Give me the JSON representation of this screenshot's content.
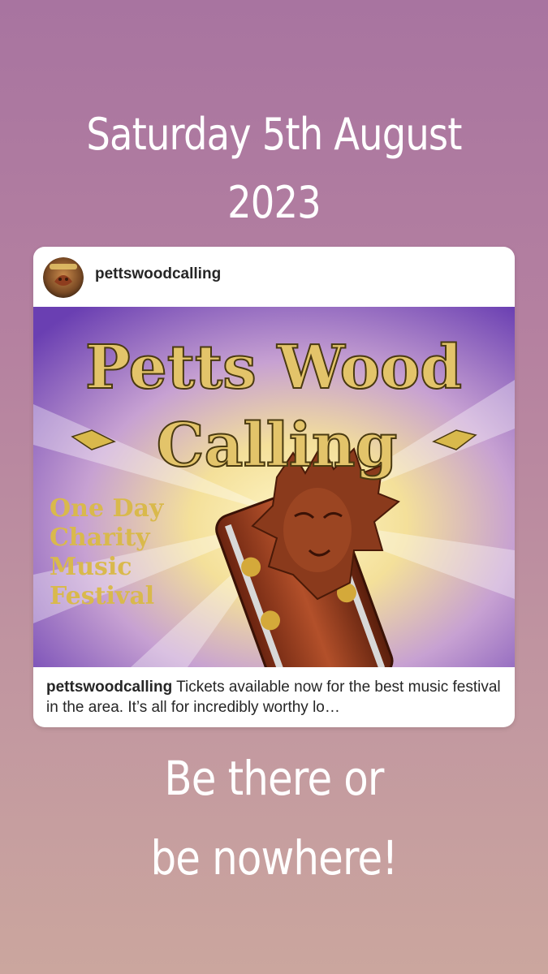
{
  "story": {
    "top_text_line1": "Saturday 5th August",
    "top_text_line2": "2023",
    "bottom_text_line1": "Be there or",
    "bottom_text_line2": "be nowhere!"
  },
  "post": {
    "username": "pettswoodcalling",
    "caption_user": "pettswoodcalling",
    "caption_text": " Tickets available now for the best music festival in the area. It’s all for incredibly worthy lo…",
    "image": {
      "title_line1": "Petts Wood",
      "title_line2": "Calling",
      "sub_line1": "One Day",
      "sub_line2": "Charity",
      "sub_line3": "Music",
      "sub_line4": "Festival"
    }
  }
}
